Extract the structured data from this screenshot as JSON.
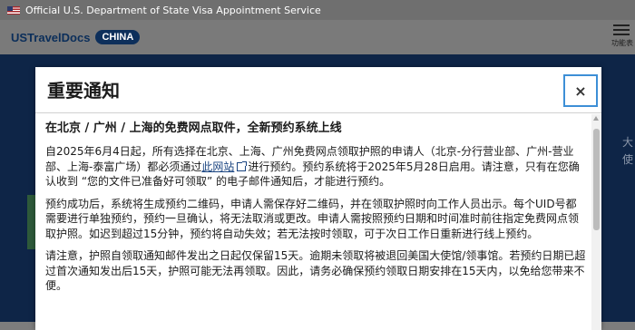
{
  "topbar": {
    "flag_icon": "us-flag-icon",
    "text": "Official U.S. Department of State Visa Appointment Service"
  },
  "navbar": {
    "brand": "USTravelDocs",
    "country": "CHINA",
    "menu_icon": "hamburger-menu-icon",
    "menu_label": "功能表"
  },
  "background": {
    "hero_title": "美",
    "hero_text_left": "欢",
    "hero_text_right_1": "大",
    "hero_text_right_2": "使"
  },
  "modal": {
    "title": "重要通知",
    "close_label": "×",
    "subheading": "在北京 / 广州 / 上海的免费网点取件，全新预约系统上线",
    "p1_before_link": "自2025年6月4日起，所有选择在北京、上海、广州免费网点领取护照的申请人（北京-分行营业部、广州-营业部、上海-泰富广场）都必须通过",
    "p1_link": "此网站",
    "p1_after_link": "进行预约。预约系统将于2025年5月28日启用。请注意，只有在您确认收到 “您的文件已准备好可领取” 的电子邮件通知后，才能进行预约。",
    "p2": "预约成功后，系统将生成预约二维码，申请人需保存好二维码，并在领取护照时向工作人员出示。每个UID号都需要进行单独预约，预约一旦确认，将无法取消或更改。申请人需按照预约日期和时间准时前往指定免费网点领取护照。如迟到超过15分钟，预约将自动失效；若无法按时领取，可于次日工作日重新进行线上预约。",
    "p3": "请注意，护照自领取通知邮件发出之日起仅保留15天。逾期未领取将被退回美国大使馆/领事馆。若预约日期已超过首次通知发出后15天，护照可能无法再领取。因此，请务必确保预约领取日期安排在15天内，以免给您带来不便。"
  },
  "colors": {
    "accent": "#3d8fd6",
    "link": "#1a4480",
    "brand_navy": "#0d2f5b"
  }
}
